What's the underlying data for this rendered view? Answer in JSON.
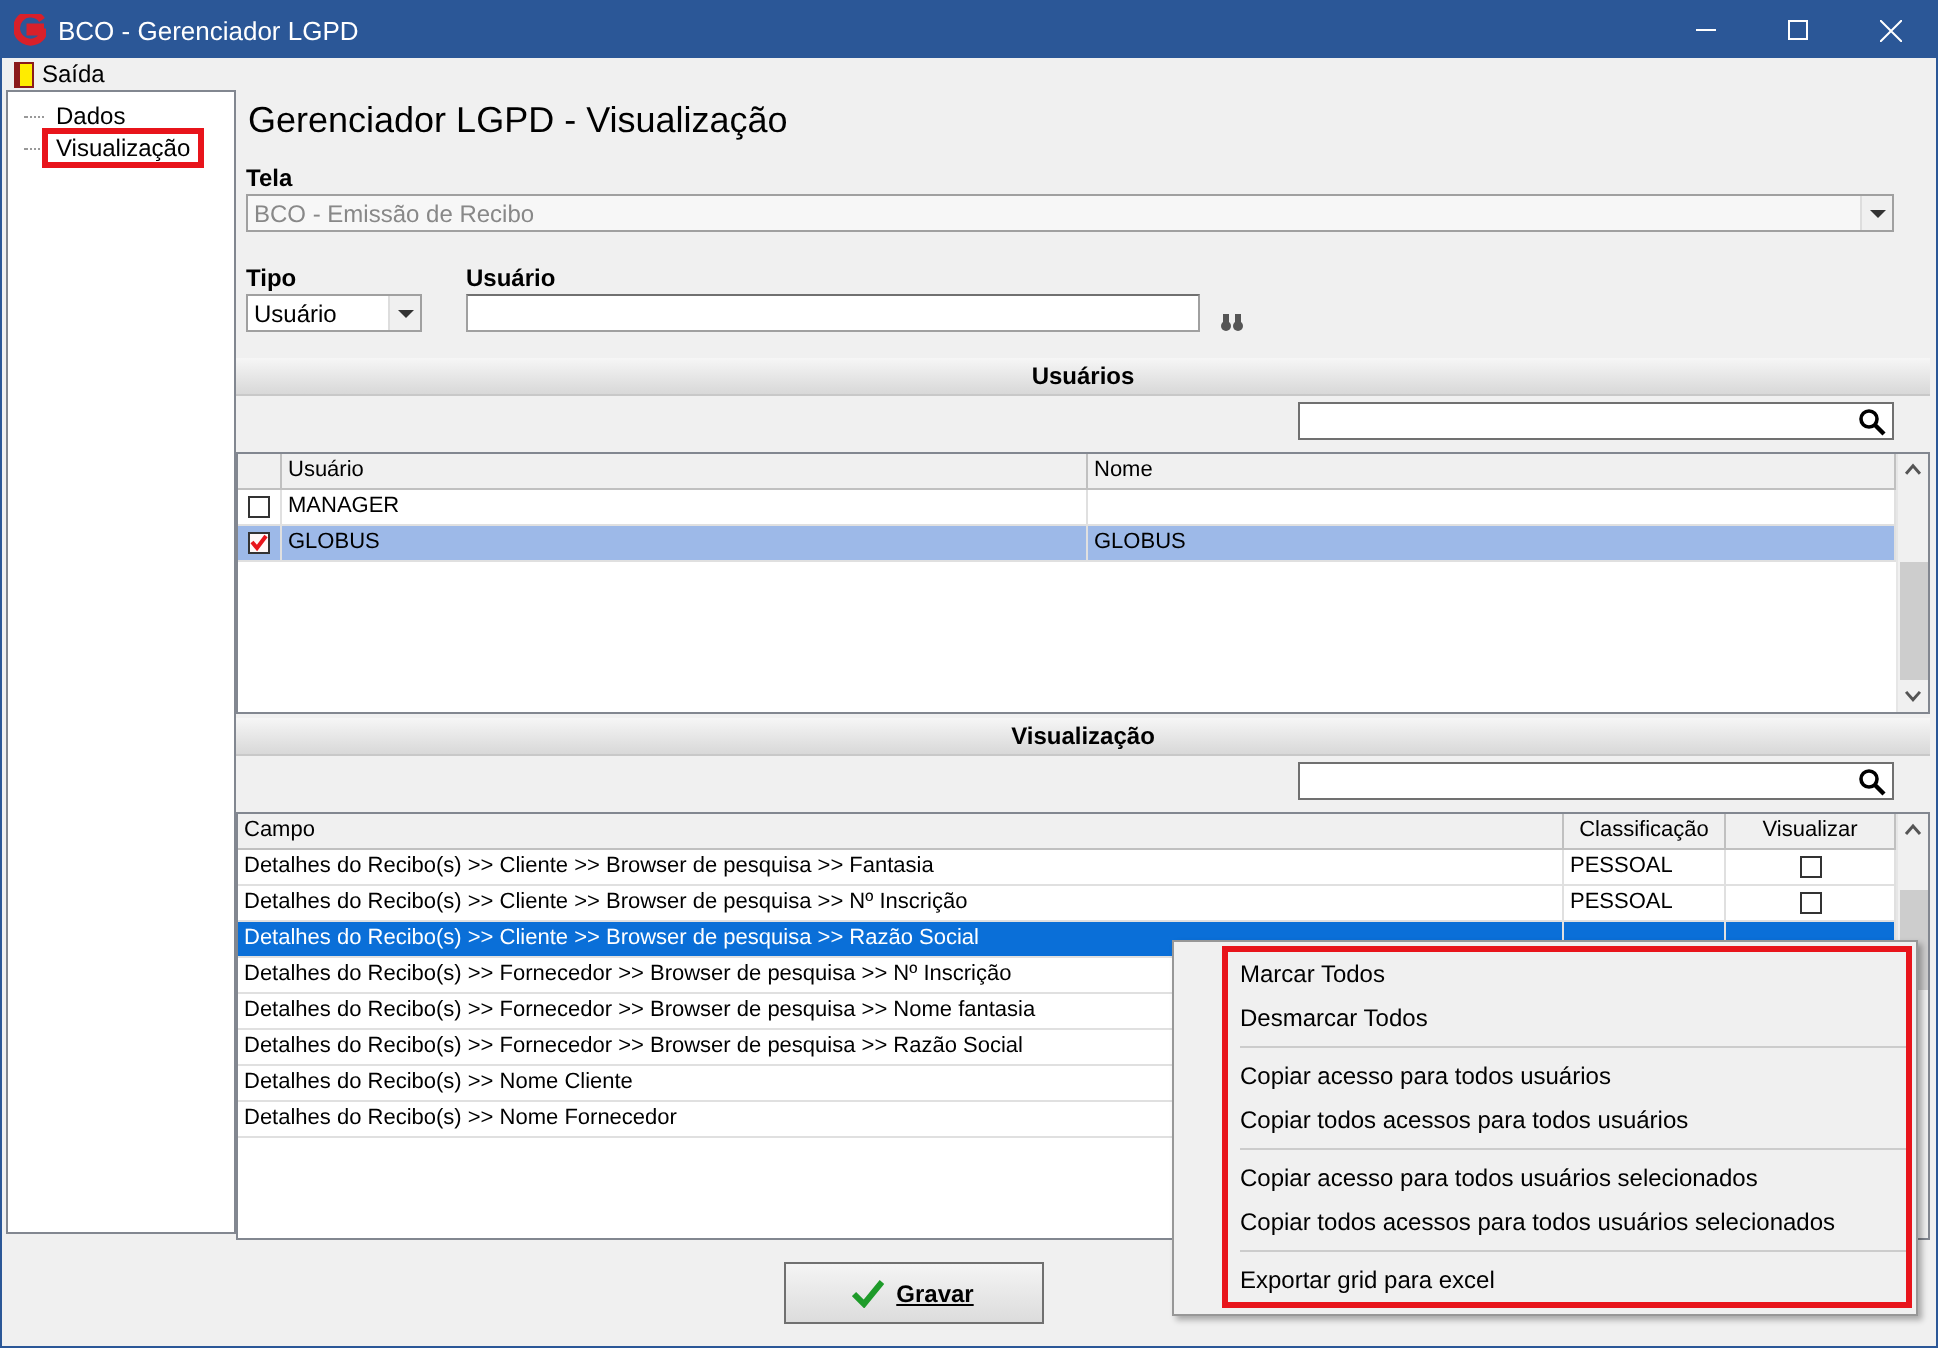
{
  "window": {
    "title": "BCO - Gerenciador LGPD"
  },
  "menu": [
    {
      "label": "Saída"
    }
  ],
  "tree": [
    {
      "label": "Dados",
      "selected": false
    },
    {
      "label": "Visualização",
      "selected": true
    }
  ],
  "heading": "Gerenciador LGPD - Visualização",
  "tela": {
    "label": "Tela",
    "value": "BCO - Emissão de Recibo",
    "disabled": true
  },
  "tipo": {
    "label": "Tipo",
    "value": "Usuário"
  },
  "usuario": {
    "label": "Usuário"
  },
  "users_section": {
    "title": "Usuários",
    "columns": [
      "Usuário",
      "Nome"
    ],
    "rows": [
      {
        "checked": false,
        "selected": false,
        "usuario": "MANAGER"
      },
      {
        "checked": true,
        "selected": true,
        "usuario": "GLOBUS",
        "nome": "GLOBUS"
      }
    ]
  },
  "view_section": {
    "title": "Visualização",
    "columns": [
      "Campo",
      "Classificação",
      "Visualizar"
    ],
    "rows": [
      {
        "selected": false,
        "campo": "Detalhes do Recibo(s) >> Cliente >> Browser de pesquisa >> Fantasia",
        "classificacao": "PESSOAL",
        "visualizar": false
      },
      {
        "selected": false,
        "campo": "Detalhes do Recibo(s) >> Cliente >> Browser de pesquisa >> Nº Inscrição",
        "classificacao": "PESSOAL",
        "visualizar": false
      },
      {
        "selected": true,
        "campo": "Detalhes do Recibo(s) >> Cliente >> Browser de pesquisa >> Razão Social"
      },
      {
        "selected": false,
        "campo": "Detalhes do Recibo(s) >> Fornecedor >> Browser de pesquisa >> Nº Inscrição"
      },
      {
        "selected": false,
        "campo": "Detalhes do Recibo(s) >> Fornecedor >> Browser de pesquisa >> Nome fantasia"
      },
      {
        "selected": false,
        "campo": "Detalhes do Recibo(s) >> Fornecedor >> Browser de pesquisa >> Razão Social"
      },
      {
        "selected": false,
        "campo": "Detalhes do Recibo(s) >> Nome Cliente"
      },
      {
        "selected": false,
        "campo": "Detalhes do Recibo(s) >> Nome Fornecedor"
      }
    ]
  },
  "save_button": {
    "label": "Gravar"
  },
  "context_menu": [
    [
      {
        "label": "Marcar Todos"
      },
      {
        "label": "Desmarcar Todos"
      }
    ],
    [
      {
        "label": "Copiar acesso para todos usuários"
      },
      {
        "label": "Copiar todos acessos para todos usuários"
      }
    ],
    [
      {
        "label": "Copiar acesso para todos usuários selecionados"
      },
      {
        "label": "Copiar todos acessos para todos usuários selecionados"
      }
    ],
    [
      {
        "label": "Exportar grid para excel"
      }
    ]
  ]
}
